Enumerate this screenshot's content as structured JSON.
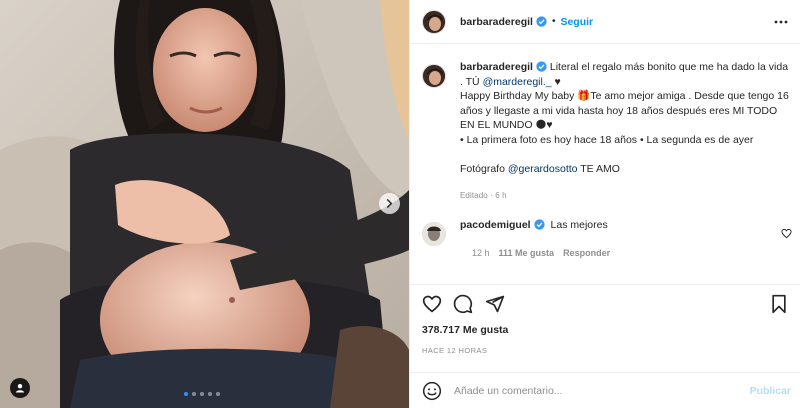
{
  "post": {
    "author": "barbaraderegil",
    "follow_label": "Seguir",
    "separator": "•",
    "carousel_dots": 5,
    "active_dot": 0
  },
  "caption": {
    "author": "barbaraderegil",
    "line1": "Literal el regalo más bonito que me ha dado la vida . TÚ ",
    "mention1": "@marderegil._",
    "line1_end": " ♥",
    "line2": "Happy Birthday My baby 🎁Te amo mejor amiga . Desde que tengo 16 años y llegaste a mi vida hasta hoy 18 años después eres MI TODO EN EL MUNDO 🌑♥",
    "line3": "• La primera foto es hoy hace 18 años • La segunda es de ayer",
    "photographer_prefix": "Fotógrafo ",
    "mention2": "@gerardosotto",
    "photographer_suffix": " TE AMO",
    "edited": "Editado · 6 h"
  },
  "comment": {
    "author": "pacodemiguel",
    "text": "Las mejores",
    "age": "12 h",
    "likes": "111 Me gusta",
    "reply": "Responder"
  },
  "stats": {
    "likes": "378.717 Me gusta",
    "time": "HACE 12 HORAS"
  },
  "composer": {
    "placeholder": "Añade un comentario...",
    "publish": "Publicar"
  },
  "colors": {
    "accent": "#0095f6",
    "verified": "#3897f0",
    "publish_disabled": "#b2dffc"
  },
  "icons": [
    "more-icon",
    "verified-icon",
    "heart-icon",
    "comment-icon",
    "share-icon",
    "bookmark-icon",
    "emoji-icon",
    "next-arrow-icon",
    "user-tag-icon"
  ]
}
